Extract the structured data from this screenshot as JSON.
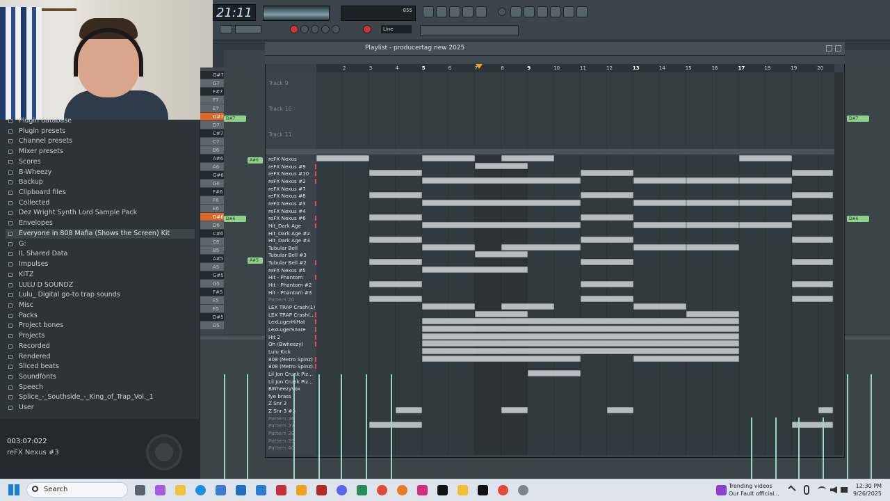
{
  "toolbar": {
    "clock": "21:11",
    "cpu_value": "855",
    "line_mode": "Line",
    "colors": {
      "accent": "#f0a020",
      "note": "#8fd08a",
      "record": "#e85050",
      "block": "#b7bdbf"
    }
  },
  "browser": {
    "items": [
      {
        "label": "Plugin database"
      },
      {
        "label": "Plugin presets"
      },
      {
        "label": "Channel presets"
      },
      {
        "label": "Mixer presets"
      },
      {
        "label": "Scores"
      },
      {
        "label": "B-Wheezy"
      },
      {
        "label": "Backup"
      },
      {
        "label": "Clipboard files"
      },
      {
        "label": "Collected"
      },
      {
        "label": "Dez Wright Synth Lord Sample Pack"
      },
      {
        "label": "Envelopes"
      },
      {
        "label": "Everyone in 808 Mafia (Shows the Screen) Kit"
      },
      {
        "label": "G:"
      },
      {
        "label": "IL Shared Data"
      },
      {
        "label": "Impulses"
      },
      {
        "label": "KITZ"
      },
      {
        "label": "LULU D SOUNDZ"
      },
      {
        "label": "Lulu_ Digital go-to trap sounds"
      },
      {
        "label": "Misc"
      },
      {
        "label": "Packs"
      },
      {
        "label": "Project bones"
      },
      {
        "label": "Projects"
      },
      {
        "label": "Recorded"
      },
      {
        "label": "Rendered"
      },
      {
        "label": "Sliced beats"
      },
      {
        "label": "Soundfonts"
      },
      {
        "label": "Speech"
      },
      {
        "label": "Splice_-_Southside_-_King_of_Trap_Vol._1"
      },
      {
        "label": "User"
      }
    ]
  },
  "status": {
    "time": "003:07:022",
    "hint": "reFX Nexus #3"
  },
  "piano": {
    "keys": [
      "G#7",
      "G7",
      "F#7",
      "F7",
      "E7",
      "D#7",
      "D7",
      "C#7",
      "C7",
      "B6",
      "A#6",
      "A6",
      "G#6",
      "G6",
      "F#6",
      "F6",
      "E6",
      "D#6",
      "D6",
      "C#6",
      "C6",
      "B5",
      "A#5",
      "A5",
      "G#5",
      "G5",
      "F#5",
      "F5",
      "E5",
      "D#5",
      "D5"
    ]
  },
  "channel_notes": [
    {
      "label": "D#7"
    },
    {
      "label": "A#6"
    },
    {
      "label": "D#6"
    },
    {
      "label": "A#5"
    }
  ],
  "right_notes": [
    {
      "label": "D#7"
    },
    {
      "label": "D#6"
    }
  ],
  "playlist": {
    "title": "Playlist - producertag new 2025",
    "ruler": [
      "2",
      "3",
      "4",
      "5",
      "6",
      "7",
      "8",
      "9",
      "10",
      "11",
      "12",
      "13",
      "14",
      "15",
      "16",
      "17",
      "18",
      "19",
      "20"
    ],
    "tracks": [
      "Track 9",
      "Track 10",
      "Track 11"
    ],
    "patterns": [
      {
        "name": "reFX Nexus",
        "dim": false
      },
      {
        "name": "reFX Nexus #9",
        "dim": false
      },
      {
        "name": "reFX Nexus #10",
        "dim": false
      },
      {
        "name": "reFX Nexus #2",
        "dim": false
      },
      {
        "name": "reFX Nexus #7",
        "dim": false
      },
      {
        "name": "reFX Nexus #8",
        "dim": false
      },
      {
        "name": "reFX Nexus #3",
        "dim": false
      },
      {
        "name": "reFX Nexus #4",
        "dim": false
      },
      {
        "name": "reFX Nexus #6",
        "dim": false
      },
      {
        "name": "Hit_Dark Age",
        "dim": false
      },
      {
        "name": "Hit_Dark Age #2",
        "dim": false
      },
      {
        "name": "Hit_Dark Age #3",
        "dim": false
      },
      {
        "name": "Tubular Bell",
        "dim": false
      },
      {
        "name": "Tubular Bell #3",
        "dim": false
      },
      {
        "name": "Tubular Bell #2",
        "dim": false
      },
      {
        "name": "reFX Nexus #5",
        "dim": false
      },
      {
        "name": "Hit - Phantom",
        "dim": false
      },
      {
        "name": "Hit - Phantom #2",
        "dim": false
      },
      {
        "name": "Hit - Phantom #3",
        "dim": false
      },
      {
        "name": "Pattern 20",
        "dim": true
      },
      {
        "name": "LEX TRAP Crash(1)",
        "dim": false
      },
      {
        "name": "LEX TRAP Crash(...",
        "dim": false
      },
      {
        "name": "LexLugerHiHat",
        "dim": false
      },
      {
        "name": "LexLugerSnare",
        "dim": false
      },
      {
        "name": "Hit 2",
        "dim": false
      },
      {
        "name": "Oh (Bwheezy)",
        "dim": false
      },
      {
        "name": "Lulu Kick",
        "dim": false
      },
      {
        "name": "808 (Metro Spinz)",
        "dim": false
      },
      {
        "name": "808 (Metro Spinz)...",
        "dim": false
      },
      {
        "name": "Lil Jon Crunk Piz...",
        "dim": false
      },
      {
        "name": "Lil Jon Crunk Piz...",
        "dim": false
      },
      {
        "name": "BWheezyVox",
        "dim": false
      },
      {
        "name": "fye brass",
        "dim": false
      },
      {
        "name": "Z Snr 3",
        "dim": false
      },
      {
        "name": "Z Snr 3 #3",
        "dim": false
      },
      {
        "name": "Pattern 36",
        "dim": true
      },
      {
        "name": "Pattern 37",
        "dim": true
      },
      {
        "name": "Pattern 38",
        "dim": true
      },
      {
        "name": "Pattern 39",
        "dim": true
      },
      {
        "name": "Pattern 40",
        "dim": true
      }
    ]
  },
  "taskbar": {
    "search": "Search",
    "trending_title": "Trending videos",
    "trending_sub": "Our Fault official...",
    "time": "12:30 PM",
    "date": "9/26/2025"
  }
}
